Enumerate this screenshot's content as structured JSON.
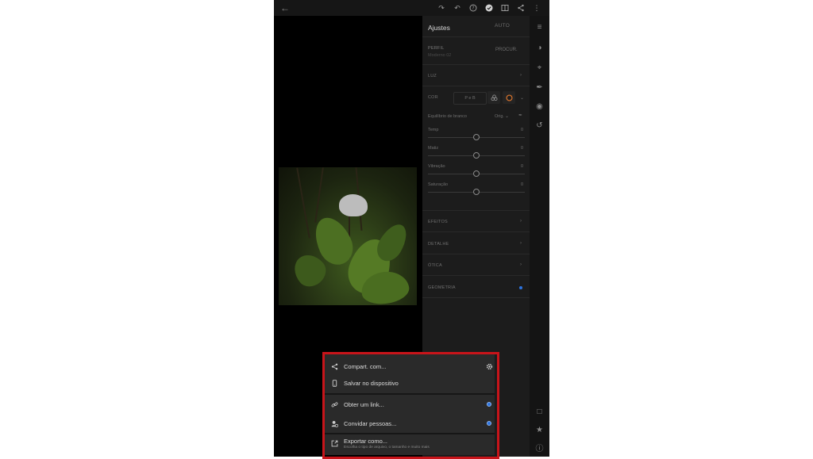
{
  "panel": {
    "title": "Ajustes",
    "auto_label": "AUTO",
    "profile_label": "PERFIL",
    "profile_value": "Moderno 02",
    "browse_label": "PROCUR.",
    "light_label": "LUZ",
    "color_label": "COR",
    "bw_label": "P e B",
    "wb_label": "Equilíbrio de branco",
    "wb_value": "Orig.",
    "sliders": [
      {
        "label": "Temp",
        "value": "0"
      },
      {
        "label": "Matiz",
        "value": "0"
      },
      {
        "label": "Vibração",
        "value": "0"
      },
      {
        "label": "Saturação",
        "value": "0"
      }
    ],
    "effects_label": "EFEITOS",
    "detail_label": "DETALHE",
    "optics_label": "ÓTICA",
    "geometry_label": "GEOMETRIA"
  },
  "share_sheet": {
    "share_with": "Compart. com...",
    "save_device": "Salvar no dispositivo",
    "get_link": "Obter um link...",
    "invite": "Convidar pessoas...",
    "export_as": "Exportar como...",
    "export_hint": "Escolha o tipo de arquivo, o tamanho e muito mais"
  },
  "colors": {
    "accent": "#2d74e0",
    "highlight_frame": "#c8141a"
  },
  "icons": {
    "back": "arrow-left-icon",
    "redo": "redo-icon",
    "undo": "undo-icon",
    "help": "help-icon",
    "done": "check-circle-icon",
    "compare": "compare-icon",
    "share": "share-icon",
    "more": "more-vertical-icon"
  }
}
